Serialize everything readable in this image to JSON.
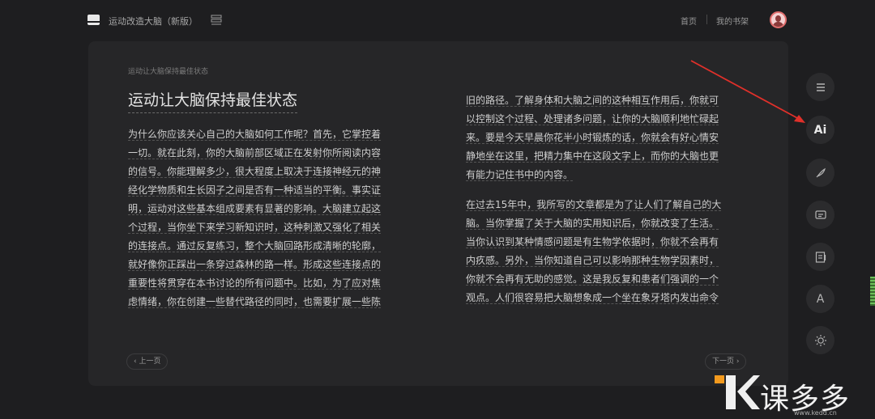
{
  "header": {
    "book_title": "运动改造大脑（新版）",
    "nav_home": "首页",
    "nav_shelf": "我的书架"
  },
  "reader": {
    "chapter_small": "运动让大脑保持最佳状态",
    "chapter_title": "运动让大脑保持最佳状态",
    "left_lines": [
      "为什么你应该关心自己的大脑如何工作呢？首先，它掌控着",
      "一切。就在此刻，你的大脑前部区域正在发射你所阅读内容",
      "的信号。你能理解多少，很大程度上取决于连接神经元的神",
      "经化学物质和生长因子之间是否有一种适当的平衡。事实证",
      "明，运动对这些基本组成要素有显著的影响。大脑建立起这",
      "个过程，当你坐下来学习新知识时，这种刺激又强化了相关",
      "的连接点。通过反复练习，整个大脑回路形成清晰的轮廓，",
      "就好像你正踩出一条穿过森林的路一样。形成这些连接点的",
      "重要性将贯穿在本书讨论的所有问题中。比如，为了应对焦",
      "虑情绪，你在创建一些替代路径的同时，也需要扩展一些陈"
    ],
    "right_lines_a": [
      "旧的路径。了解身体和大脑之间的这种相互作用后，你就可",
      "以控制这个过程、处理诸多问题，让你的大脑顺利地忙碌起",
      "来。要是今天早晨你花半小时锻炼的话，你就会有好心情安",
      "静地坐在这里，把精力集中在这段文字上，而你的大脑也更",
      "有能力记住书中的内容。"
    ],
    "right_lines_b": [
      "在过去15年中，我所写的文章都是为了让人们了解自己的大",
      "脑。当你掌握了关于大脑的实用知识后，你就改变了生活。",
      "当你认识到某种情感问题是有生物学依据时，你就不会再有",
      "内疚感。另外，当你知道自己可以影响那种生物学因素时，",
      "你就不会再有无助的感觉。这是我反复和患者们强调的一个",
      "观点。人们很容易把大脑想象成一个坐在象牙塔内发出命令"
    ],
    "prev_label": "‹ 上一页",
    "next_label": "下一页 ›"
  },
  "toolbar": {
    "icons": [
      "menu-icon",
      "ai-icon",
      "pen-icon",
      "comment-icon",
      "note-icon",
      "font-icon",
      "brightness-icon"
    ],
    "ai_label": "Ai",
    "font_label": "A"
  },
  "watermark": {
    "brand_text": "课多多",
    "url": "www.kedd.cn"
  },
  "colors": {
    "background": "#1e1e20",
    "panel": "#262628",
    "arrow": "#e0302a",
    "watermark_accent": "#f39a1e"
  }
}
